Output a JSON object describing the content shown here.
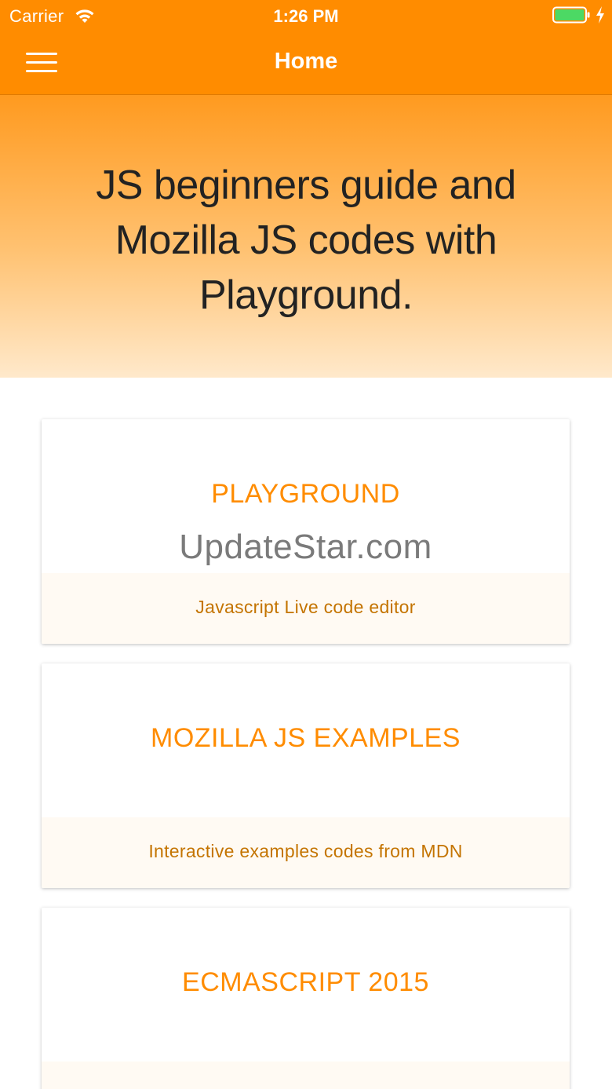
{
  "status_bar": {
    "carrier": "Carrier",
    "time": "1:26 PM",
    "wifi_icon": "wifi-icon",
    "battery_icon": "battery-full-icon",
    "battery_color": "#4cd964"
  },
  "nav": {
    "title": "Home",
    "menu_icon": "hamburger-menu-icon"
  },
  "hero": {
    "text": "JS beginners guide and Mozilla JS codes with Playground."
  },
  "cards": [
    {
      "title": "PLAYGROUND",
      "subtitle": "Javascript Live code editor",
      "watermark": "UpdateStar.com"
    },
    {
      "title": "MOZILLA JS EXAMPLES",
      "subtitle": "Interactive examples codes from MDN"
    },
    {
      "title": "ECMASCRIPT 2015",
      "subtitle": ""
    }
  ],
  "colors": {
    "accent": "#ff8c00",
    "card_title": "#ff8c00",
    "card_subtitle": "#c47400"
  }
}
